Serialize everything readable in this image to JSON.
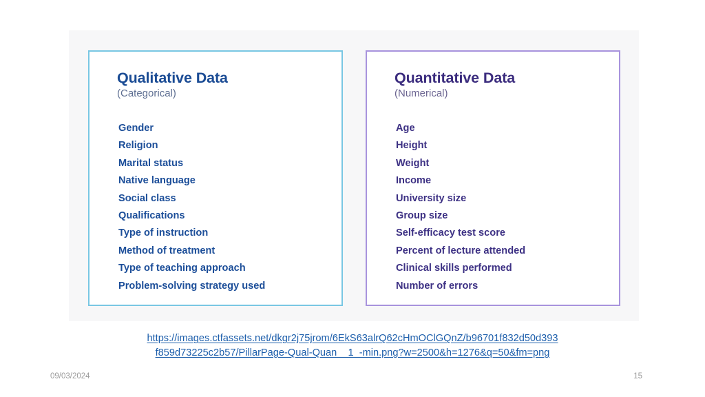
{
  "slide": {
    "background_color": "#ffffff",
    "panel_background_color": "#f7f7f8"
  },
  "cards": {
    "qualitative": {
      "title": "Qualitative Data",
      "subtitle": "(Categorical)",
      "border_color": "#79c7e3",
      "title_color": "#1a4b94",
      "subtitle_color": "#5d6e91",
      "item_color": "#1c4e99",
      "items": [
        "Gender",
        "Religion",
        "Marital status",
        "Native language",
        "Social class",
        "Qualifications",
        "Type of instruction",
        "Method of treatment",
        "Type of teaching approach",
        "Problem-solving strategy used"
      ]
    },
    "quantitative": {
      "title": "Quantitative Data",
      "subtitle": "(Numerical)",
      "border_color": "#a893dd",
      "title_color": "#3b2c7e",
      "subtitle_color": "#6a6390",
      "item_color": "#3d3184",
      "items": [
        "Age",
        "Height",
        "Weight",
        "Income",
        "University size",
        "Group size",
        "Self-efficacy test score",
        "Percent of lecture attended",
        "Clinical skills performed",
        "Number of errors"
      ]
    }
  },
  "source_link": {
    "color": "#1c5eab",
    "line1": "https://images.ctfassets.net/dkgr2j75jrom/6EkS63alrQ62cHmOClGQnZ/b96701f832d50d393",
    "line2": "f859d73225c2b57/PillarPage-Qual-Quan__1_-min.png?w=2500&h=1276&q=50&fm=png"
  },
  "footer": {
    "date": "09/03/2024",
    "page_number": "15",
    "color": "#9a9a9a"
  }
}
